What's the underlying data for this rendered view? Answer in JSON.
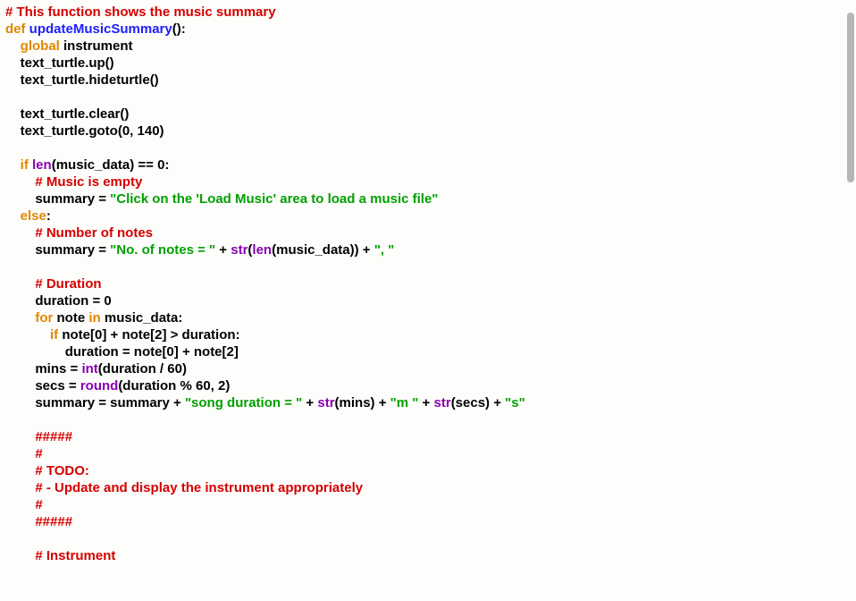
{
  "code": {
    "l01": {
      "comment": "# This function shows the music summary"
    },
    "l02": {
      "kw_def": "def",
      "name": "updateMusicSummary",
      "tail": "():"
    },
    "l03": {
      "kw_global": "global",
      "rest": " instrument"
    },
    "l04": {
      "txt": "text_turtle.up()"
    },
    "l05": {
      "txt": "text_turtle.hideturtle()"
    },
    "l06": {
      "txt": ""
    },
    "l07": {
      "txt": "text_turtle.clear()"
    },
    "l08": {
      "txt": "text_turtle.goto(0, 140)"
    },
    "l09": {
      "txt": ""
    },
    "l10": {
      "kw_if": "if",
      "sp": " ",
      "fn_len": "len",
      "mid": "(music_data) == 0:"
    },
    "l11": {
      "comment": "# Music is empty"
    },
    "l12": {
      "pre": "summary = ",
      "str": "\"Click on the 'Load Music' area to load a music file\""
    },
    "l13": {
      "kw_else": "else",
      "colon": ":"
    },
    "l14": {
      "comment": "# Number of notes"
    },
    "l15": {
      "pre": "summary = ",
      "str1": "\"No. of notes = \"",
      "mid1": " + ",
      "fn_str": "str",
      "open": "(",
      "fn_len": "len",
      "mid2": "(music_data)) + ",
      "str2": "\", \""
    },
    "l16": {
      "txt": ""
    },
    "l17": {
      "comment": "# Duration"
    },
    "l18": {
      "txt": "duration = 0"
    },
    "l19": {
      "kw_for": "for",
      "mid1": " note ",
      "kw_in": "in",
      "mid2": " music_data:"
    },
    "l20": {
      "kw_if": "if",
      "rest": " note[0] + note[2] > duration:"
    },
    "l21": {
      "txt": "duration = note[0] + note[2]"
    },
    "l22": {
      "pre": "mins = ",
      "fn_int": "int",
      "rest": "(duration / 60)"
    },
    "l23": {
      "pre": "secs = ",
      "fn_round": "round",
      "rest": "(duration % 60, 2)"
    },
    "l24": {
      "pre": "summary = summary + ",
      "str1": "\"song duration = \"",
      "mid1": " + ",
      "fn_str1": "str",
      "arg1": "(mins) + ",
      "str2": "\"m \"",
      "mid2": " + ",
      "fn_str2": "str",
      "arg2": "(secs) + ",
      "str3": "\"s\""
    },
    "l25": {
      "txt": ""
    },
    "l26": {
      "comment": "#####"
    },
    "l27": {
      "comment": "#"
    },
    "l28": {
      "comment": "# TODO:"
    },
    "l29": {
      "comment": "# - Update and display the instrument appropriately"
    },
    "l30": {
      "comment": "#"
    },
    "l31": {
      "comment": "#####"
    },
    "l32": {
      "txt": ""
    },
    "l33": {
      "comment": "# Instrument"
    }
  },
  "indent": {
    "i0": "",
    "i1": "    ",
    "i2": "        ",
    "i3": "            ",
    "i4": "                "
  }
}
